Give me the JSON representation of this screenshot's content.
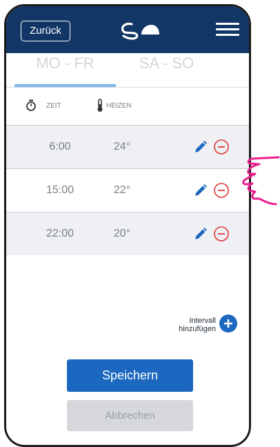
{
  "header": {
    "back_label": "Zurück"
  },
  "tabs": [
    {
      "label": "MO - FR",
      "active": true
    },
    {
      "label": "SA - SO",
      "active": false
    }
  ],
  "columns": {
    "time_label": "ZEIT",
    "heat_label": "HEIZEN"
  },
  "schedule": [
    {
      "time": "6:00",
      "temp": "24°"
    },
    {
      "time": "15:00",
      "temp": "22°"
    },
    {
      "time": "22:00",
      "temp": "20°"
    }
  ],
  "add_interval": {
    "label_line1": "Intervall",
    "label_line2": "hinzufügen"
  },
  "actions": {
    "save_label": "Speichern",
    "cancel_label": "Abbrechen"
  },
  "colors": {
    "header": "#123766",
    "primary": "#1c68c0",
    "remove": "#e0353a"
  }
}
